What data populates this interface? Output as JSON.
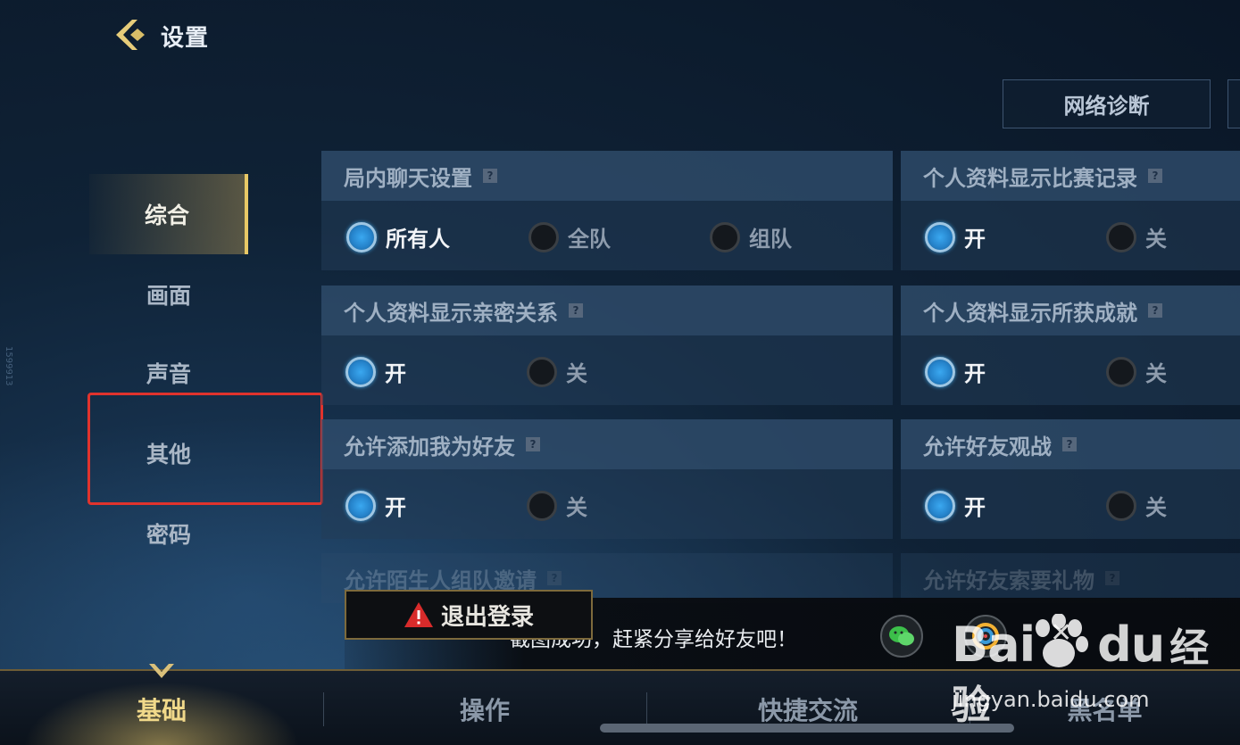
{
  "header": {
    "title": "设置",
    "network_button": "网络诊断"
  },
  "side_id": "1599913",
  "sidebar": {
    "items": [
      {
        "label": "综合",
        "active": true
      },
      {
        "label": "画面",
        "active": false
      },
      {
        "label": "声音",
        "active": false
      },
      {
        "label": "其他",
        "active": false,
        "highlighted": true
      },
      {
        "label": "密码",
        "active": false
      }
    ]
  },
  "panels": {
    "chat": {
      "title": "局内聊天设置",
      "options": [
        "所有人",
        "全队",
        "组队"
      ],
      "selected": "所有人"
    },
    "match_record": {
      "title": "个人资料显示比赛记录",
      "options": [
        "开",
        "关"
      ],
      "selected": "开"
    },
    "intimacy": {
      "title": "个人资料显示亲密关系",
      "options": [
        "开",
        "关"
      ],
      "selected": "开"
    },
    "achievements": {
      "title": "个人资料显示所获成就",
      "options": [
        "开",
        "关"
      ],
      "selected": "开"
    },
    "add_friend": {
      "title": "允许添加我为好友",
      "options": [
        "开",
        "关"
      ],
      "selected": "开"
    },
    "spectate": {
      "title": "允许好友观战",
      "options": [
        "开",
        "关"
      ],
      "selected": "开"
    },
    "stranger_invite": {
      "title": "允许陌生人组队邀请"
    },
    "gift_request": {
      "title": "允许好友索要礼物"
    }
  },
  "help_icon": "?",
  "logout_button": "退出登录",
  "toast": {
    "message": "截图成功，赶紧分享给好友吧！",
    "close": "✕"
  },
  "bottom_tabs": [
    {
      "label": "基础",
      "active": true
    },
    {
      "label": "操作",
      "active": false
    },
    {
      "label": "快捷交流",
      "active": false
    },
    {
      "label": "黑名单",
      "active": false
    }
  ],
  "watermark": {
    "logo": "Bai",
    "logo_suffix": "du",
    "logo_cn": "经验",
    "url": "jingyan.baidu.com"
  },
  "colors": {
    "accent_gold": "#e8c866",
    "radio_on": "#2684cc",
    "highlight_red": "#e0332d",
    "warning_red": "#d82b2b"
  }
}
